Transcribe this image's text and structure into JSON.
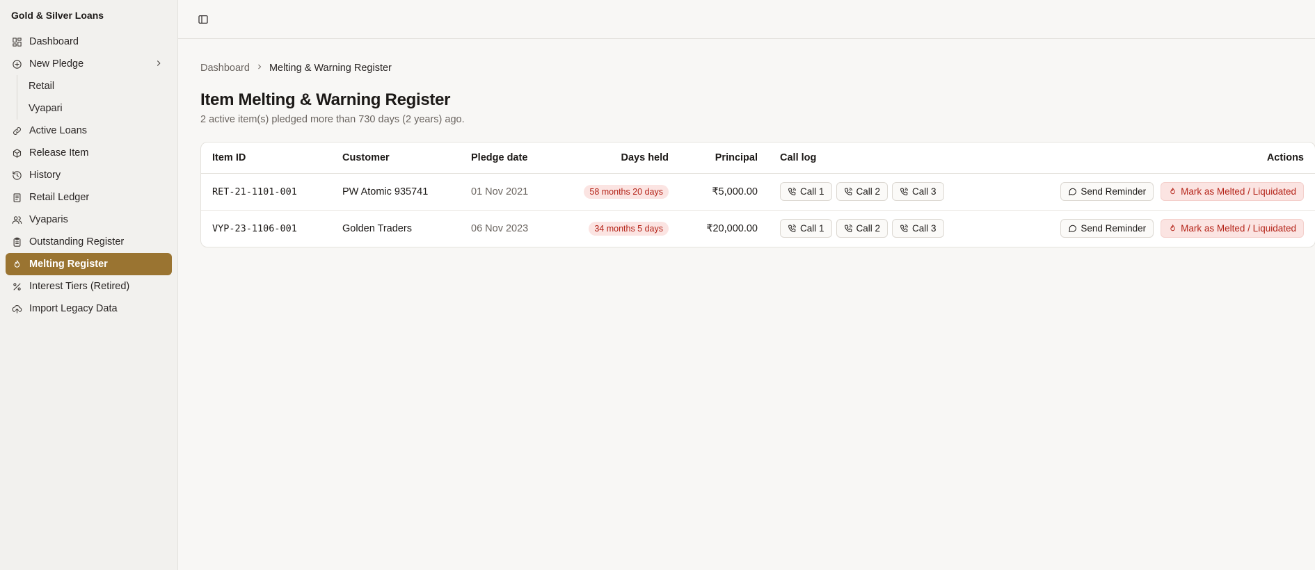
{
  "app": {
    "title": "Gold & Silver Loans"
  },
  "sidebar": {
    "items": [
      {
        "label": "Dashboard",
        "icon": "dashboard-icon"
      },
      {
        "label": "New Pledge",
        "icon": "plus-circle-icon"
      },
      {
        "label": "Active Loans",
        "icon": "link-icon"
      },
      {
        "label": "Release Item",
        "icon": "package-icon"
      },
      {
        "label": "History",
        "icon": "history-icon"
      },
      {
        "label": "Retail Ledger",
        "icon": "ledger-icon"
      },
      {
        "label": "Vyaparis",
        "icon": "users-icon"
      },
      {
        "label": "Outstanding Register",
        "icon": "clipboard-icon"
      },
      {
        "label": "Melting Register",
        "icon": "flame-icon",
        "active": true
      },
      {
        "label": "Interest Tiers (Retired)",
        "icon": "percent-icon"
      },
      {
        "label": "Import Legacy Data",
        "icon": "cloud-upload-icon"
      }
    ],
    "sub_items": [
      {
        "label": "Retail"
      },
      {
        "label": "Vyapari"
      }
    ]
  },
  "breadcrumb": {
    "root": "Dashboard",
    "current": "Melting & Warning Register"
  },
  "page": {
    "title": "Item Melting & Warning Register",
    "subtitle": "2 active item(s) pledged more than 730 days (2 years) ago."
  },
  "table": {
    "headers": {
      "item_id": "Item ID",
      "customer": "Customer",
      "pledge_date": "Pledge date",
      "days_held": "Days held",
      "principal": "Principal",
      "call_log": "Call log",
      "actions": "Actions"
    },
    "rows": [
      {
        "item_id": "RET-21-1101-001",
        "customer": "PW Atomic 935741",
        "pledge_date": "01 Nov 2021",
        "days_held": "58 months 20 days",
        "principal": "₹5,000.00",
        "calls": [
          "Call 1",
          "Call 2",
          "Call 3"
        ],
        "reminder": "Send Reminder",
        "melt": "Mark as Melted / Liquidated"
      },
      {
        "item_id": "VYP-23-1106-001",
        "customer": "Golden Traders",
        "pledge_date": "06 Nov 2023",
        "days_held": "34 months 5 days",
        "principal": "₹20,000.00",
        "calls": [
          "Call 1",
          "Call 2",
          "Call 3"
        ],
        "reminder": "Send Reminder",
        "melt": "Mark as Melted / Liquidated"
      }
    ]
  },
  "colors": {
    "accent": "#9a7431",
    "danger": "#b42318",
    "danger_bg": "#fbe4e2"
  }
}
